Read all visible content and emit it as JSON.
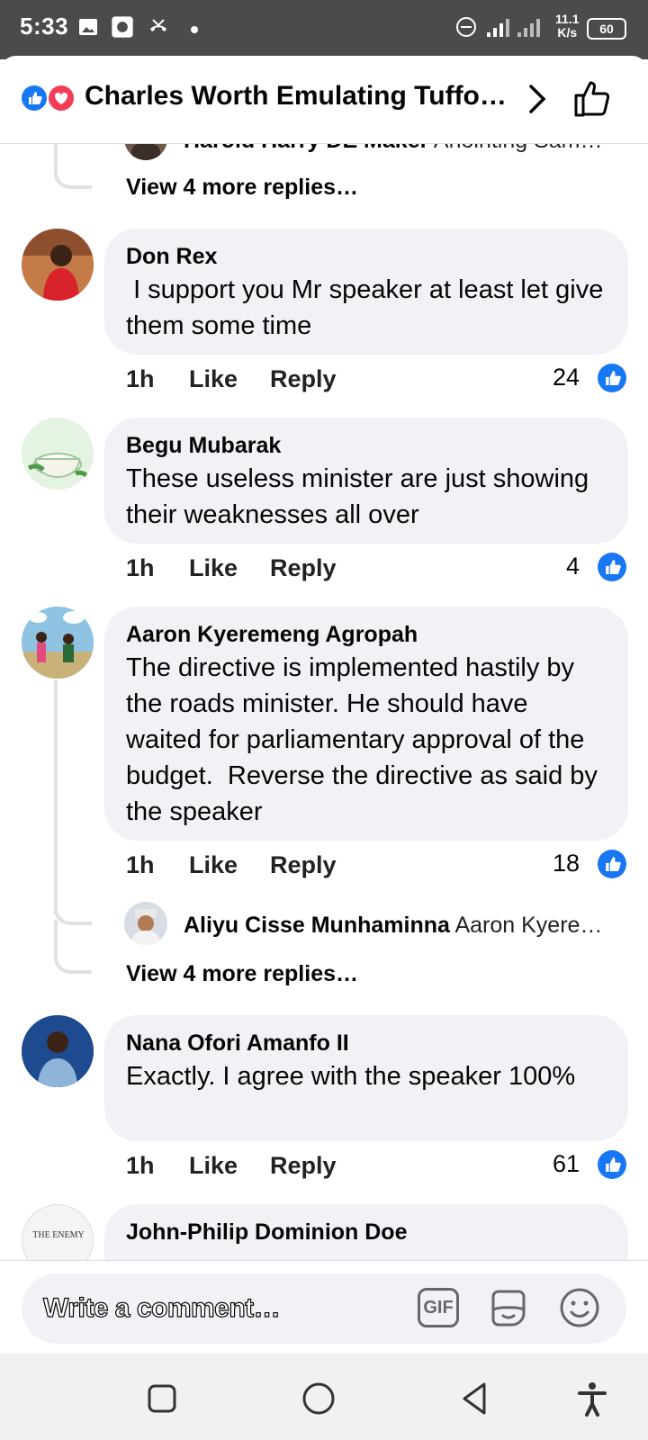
{
  "status_bar": {
    "time": "5:33",
    "net_speed_value": "11.1",
    "net_speed_unit": "K/s",
    "battery": "60"
  },
  "header": {
    "title": "Charles Worth Emulating Tuffo…"
  },
  "top_partial_reply": {
    "author": "Harold Harry DE Maker",
    "text": "Anointing Sam…"
  },
  "view_more_1": "View 4 more replies…",
  "comments": [
    {
      "author": "Don Rex",
      "text": " I support you Mr speaker at least let give them some time",
      "time": "1h",
      "like_label": "Like",
      "reply_label": "Reply",
      "likes": "24"
    },
    {
      "author": "Begu Mubarak",
      "text": "These useless minister are just showing their weaknesses all over",
      "time": "1h",
      "like_label": "Like",
      "reply_label": "Reply",
      "likes": "4"
    },
    {
      "author": "Aaron Kyeremeng Agropah",
      "text": "The directive is implemented hastily by the roads minister. He should have waited for parliamentary approval of the budget.  Reverse the directive as said by the speaker",
      "time": "1h",
      "like_label": "Like",
      "reply_label": "Reply",
      "likes": "18"
    },
    {
      "author": "Nana Ofori Amanfo II",
      "text": "Exactly. I agree with the speaker 100%",
      "time": "1h",
      "like_label": "Like",
      "reply_label": "Reply",
      "likes": "61"
    },
    {
      "author": "John-Philip Dominion Doe",
      "avatar_text": "THE ENEMY"
    }
  ],
  "reply_preview": {
    "author": "Aliyu Cisse Munhaminna",
    "text": "Aaron Kyere…"
  },
  "view_more_2": "View 4 more replies…",
  "composer": {
    "placeholder": "Write a comment…",
    "gif_label": "GIF"
  },
  "colors": {
    "accent": "#1877f2",
    "love": "#f33e58",
    "bubble": "#f0f2f5"
  }
}
